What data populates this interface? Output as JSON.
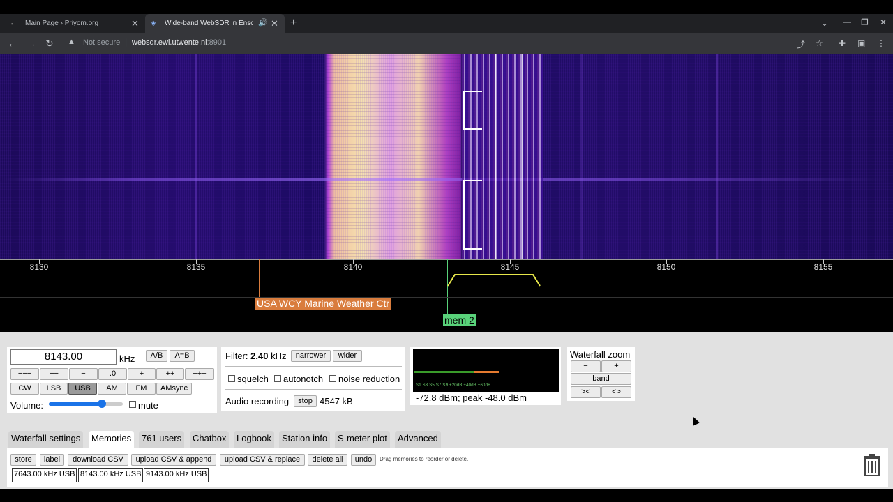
{
  "browser": {
    "tabs": [
      {
        "title": "Main Page › Priyom.org",
        "active": false
      },
      {
        "title": "Wide-band WebSDR in Enschede",
        "active": true
      }
    ],
    "new_tab": "+",
    "not_secure": "Not secure",
    "url_host": "websdr.ewi.utwente.nl",
    "url_port": ":8901"
  },
  "scale": {
    "ticks": [
      "8130",
      "8135",
      "8140",
      "8145",
      "8150",
      "8155"
    ],
    "station_label": "USA WCY Marine Weather Ctr",
    "memory_label": "mem 2"
  },
  "freq": {
    "value": "8143.00",
    "unit": "kHz",
    "ab": "A/B",
    "aeqb": "A=B",
    "steps": [
      "−−−",
      "−−",
      "−",
      ".0",
      "+",
      "++",
      "+++"
    ],
    "modes": [
      "CW",
      "LSB",
      "USB",
      "AM",
      "FM",
      "AMsync"
    ],
    "active_mode": "USB",
    "volume_label": "Volume:",
    "volume_level": 0.72,
    "mute_label": "mute"
  },
  "filter": {
    "label": "Filter:",
    "value": "2.40",
    "unit": "kHz",
    "narrower": "narrower",
    "wider": "wider",
    "squelch": "squelch",
    "autonotch": "autonotch",
    "noise_reduction": "noise reduction",
    "audio_recording": "Audio recording",
    "stop": "stop",
    "size": "4547 kB"
  },
  "smeter": {
    "scale": "S1    S3    S5    S7    S9    +20dB    +40dB    +60dB",
    "readout": "-72.8 dBm; peak  -48.0 dBm",
    "level": 0.59
  },
  "zoom": {
    "title": "Waterfall zoom",
    "minus": "−",
    "plus": "+",
    "band": "band",
    "narrow": "><",
    "wide": "<>"
  },
  "panel_tabs": [
    "Waterfall settings",
    "Memories",
    "761 users",
    "Chatbox",
    "Logbook",
    "Station info",
    "S-meter plot",
    "Advanced"
  ],
  "active_panel_tab": "Memories",
  "memories": {
    "buttons": [
      "store",
      "label",
      "download CSV",
      "upload CSV & append",
      "upload CSV & replace",
      "delete all",
      "undo"
    ],
    "hint": "Drag memories to reorder or delete.",
    "entries": [
      "7643.00 kHz USB",
      "8143.00 kHz USB",
      "9143.00 kHz USB"
    ]
  },
  "colors": {
    "station_tag": "#d97c3d",
    "memory_tag": "#59d27a",
    "passband": "#e6e64a",
    "tune_line": "#59d27a"
  }
}
